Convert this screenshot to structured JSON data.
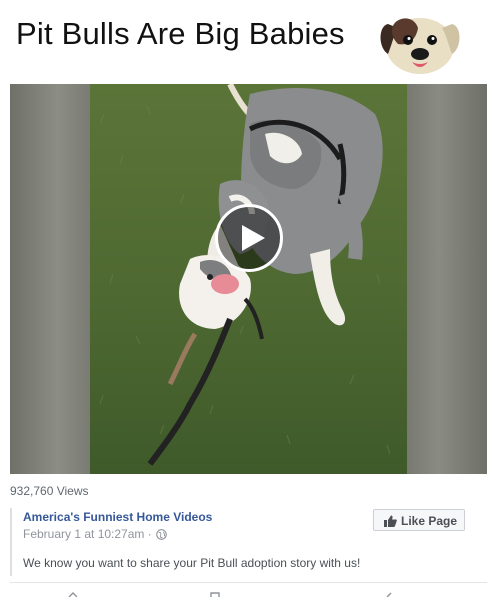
{
  "header": {
    "title": "Pit Bulls Are Big Babies",
    "icon": "puppy-face-emoji"
  },
  "video": {
    "play_icon": "play-icon",
    "views": "932,760 Views"
  },
  "post": {
    "page_name": "America's Funniest Home Videos",
    "date": "February 1 at 10:27am ·",
    "privacy_icon": "globe-icon",
    "like_button_label": "Like Page",
    "like_icon": "thumbs-up-icon",
    "text": "We know you want to share your Pit Bull adoption story with us!"
  },
  "actions": {
    "icons": [
      "share-icon",
      "comment-icon",
      "forward-icon"
    ]
  },
  "colors": {
    "link": "#365899",
    "meta": "#90949c",
    "body_text": "#4b4f56",
    "grass": "#4f6a32"
  }
}
